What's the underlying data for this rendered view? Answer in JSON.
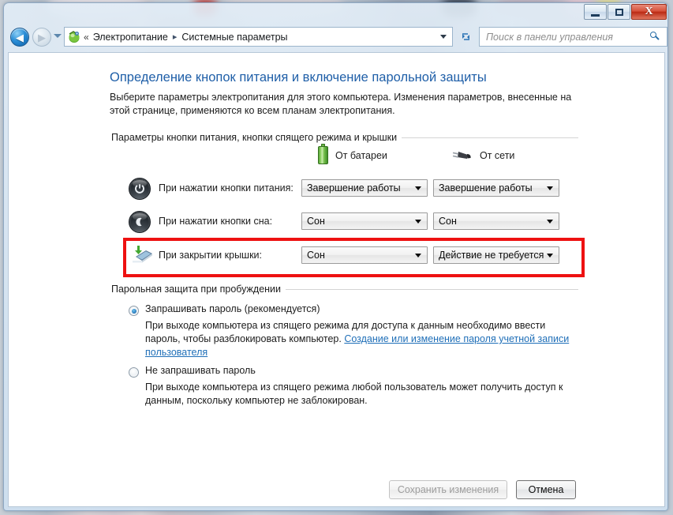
{
  "window": {
    "controls": {
      "minimize": "–",
      "maximize": "□",
      "close": "X"
    }
  },
  "navbar": {
    "back_glyph": "◀",
    "forward_glyph": "▶",
    "breadcrumb": {
      "chevrons": "«",
      "items": [
        "Электропитание",
        "Системные параметры"
      ],
      "separator": "▸"
    },
    "refresh_glyph": "↻",
    "search": {
      "placeholder": "Поиск в панели управления"
    }
  },
  "page": {
    "title": "Определение кнопок питания и включение парольной защиты",
    "description": "Выберите параметры электропитания для этого компьютера. Изменения параметров, внесенные на этой странице, применяются ко всем планам электропитания."
  },
  "buttons_group": {
    "label": "Параметры кнопки питания, кнопки спящего режима и крышки",
    "columns": [
      {
        "label": "От батареи",
        "icon": "battery-icon"
      },
      {
        "label": "От сети",
        "icon": "power-plug-icon"
      }
    ],
    "rows": [
      {
        "icon": "power-button-icon",
        "label": "При нажатии кнопки питания:",
        "battery_value": "Завершение работы",
        "ac_value": "Завершение работы"
      },
      {
        "icon": "sleep-button-icon",
        "label": "При нажатии кнопки сна:",
        "battery_value": "Сон",
        "ac_value": "Сон"
      },
      {
        "icon": "laptop-lid-icon",
        "label": "При закрытии крышки:",
        "battery_value": "Сон",
        "ac_value": "Действие не требуется"
      }
    ]
  },
  "password_group": {
    "label": "Парольная защита при пробуждении",
    "options": [
      {
        "title": "Запрашивать пароль (рекомендуется)",
        "selected": true,
        "description_before": "При выходе компьютера из спящего режима для доступа к данным необходимо ввести пароль, чтобы разблокировать компьютер. ",
        "link_text": "Создание или изменение пароля учетной записи пользователя"
      },
      {
        "title": "Не запрашивать пароль",
        "selected": false,
        "description": "При выходе компьютера из спящего режима любой пользователь может получить доступ к данным, поскольку компьютер не заблокирован."
      }
    ]
  },
  "actions": {
    "save_label": "Сохранить изменения",
    "save_enabled": false,
    "cancel_label": "Отмена"
  },
  "annotation": {
    "color": "#ee1111",
    "target": "lid-close-row"
  }
}
